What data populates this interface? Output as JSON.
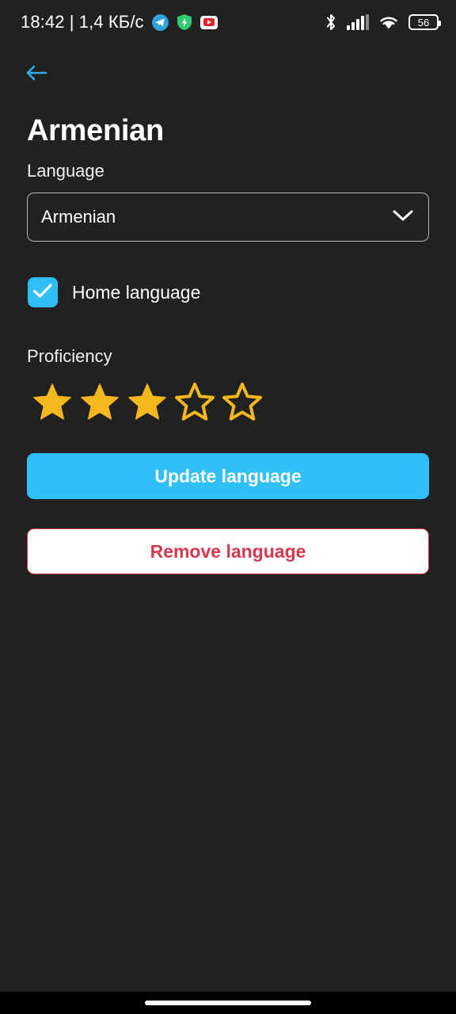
{
  "status_bar": {
    "clock_and_traffic": "18:42 | 1,4 КБ/с",
    "left_icons": [
      {
        "name": "telegram-icon",
        "label": "Telegram"
      },
      {
        "name": "shield-icon",
        "label": "Security shield"
      },
      {
        "name": "youtube-icon",
        "label": "YouTube"
      }
    ],
    "right_icons": [
      {
        "name": "bluetooth-icon",
        "label": "Bluetooth"
      },
      {
        "name": "cellular-signal-icon",
        "label": "Signal"
      },
      {
        "name": "wifi-icon",
        "label": "Wi-Fi"
      }
    ],
    "battery_percent": "56"
  },
  "nav": {
    "back_icon": "back-arrow-icon"
  },
  "header": {
    "title": "Armenian"
  },
  "form": {
    "language": {
      "label": "Language",
      "selected": "Armenian",
      "chevron_icon": "chevron-down-icon"
    },
    "home_language": {
      "label": "Home language",
      "checked": true,
      "check_icon": "checkmark-icon"
    },
    "proficiency": {
      "label": "Proficiency",
      "rating": 3,
      "max": 5
    }
  },
  "actions": {
    "update_label": "Update language",
    "remove_label": "Remove language"
  },
  "colors": {
    "background": "#212121",
    "accent_blue": "#30C0F7",
    "danger_red": "#D7374F",
    "star_gold": "#F5B71E",
    "text_primary": "#FFFFFF"
  }
}
